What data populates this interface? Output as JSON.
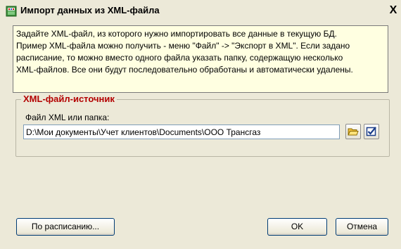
{
  "window": {
    "title": "Импорт данных из XML-файла",
    "close_glyph": "X"
  },
  "info": {
    "lines": [
      "Задайте XML-файл, из которого нужно импортировать все данные в текущую БД.",
      "Пример XML-файла можно получить - меню \"Файл\" -> \"Экспорт в XML\". Если задано",
      "расписание, то можно вместо одного файла указать папку, содержащую несколько",
      "XML-файлов. Все они будут последовательно обработаны и автоматически удалены."
    ]
  },
  "source_group": {
    "legend": "XML-файл-источник",
    "field_label": "Файл XML или папка:",
    "path_value": "D:\\Мои документы\\Учет клиентов\\Documents\\ООО Трансгаз"
  },
  "buttons": {
    "schedule": "По расписанию...",
    "ok": "OK",
    "cancel": "Отмена"
  },
  "icons": {
    "title": "xml-file-icon",
    "browse": "open-folder-icon",
    "check": "checkmark-icon"
  }
}
